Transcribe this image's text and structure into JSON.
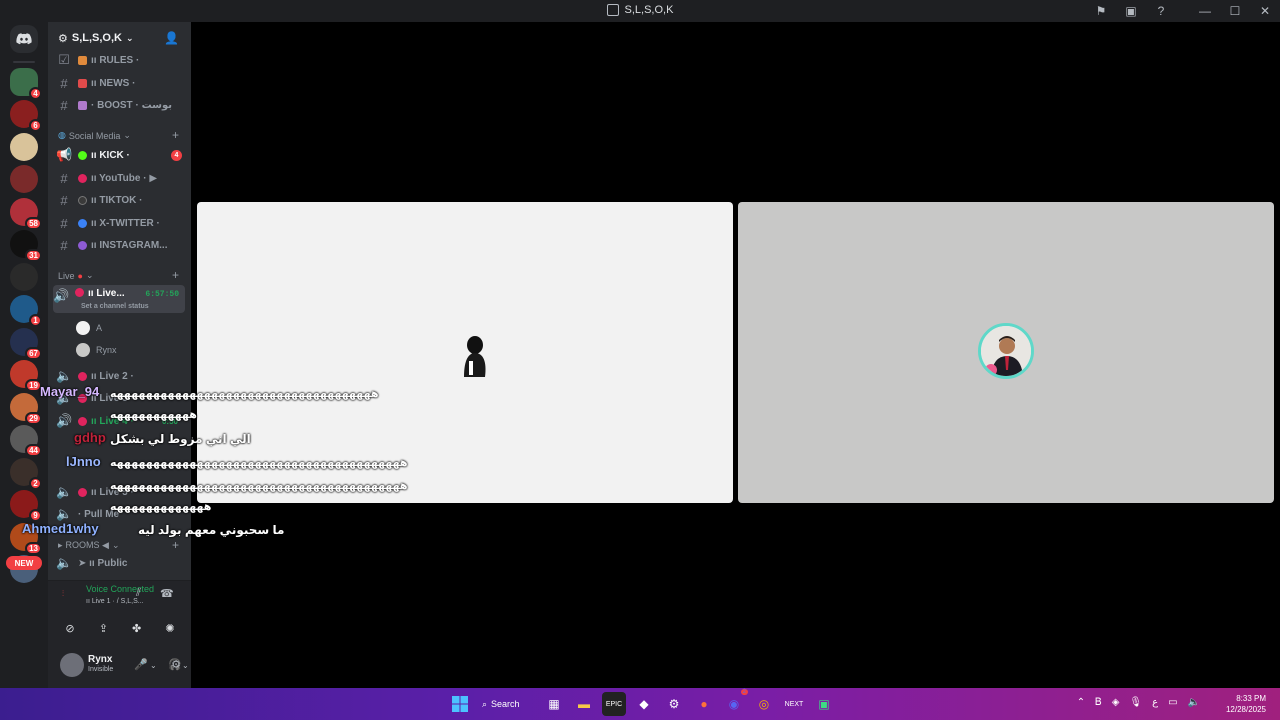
{
  "window": {
    "title": "S,L,S,O,K"
  },
  "server": {
    "name": "S,L,S,O,K"
  },
  "rail": {
    "servers": [
      {
        "badge": "4",
        "color": "#3b6e4a",
        "active": true
      },
      {
        "badge": "6",
        "color": "#8a1f1f"
      },
      {
        "badge": "",
        "color": "#d9c39a"
      },
      {
        "badge": "",
        "color": "#7a2a2a"
      },
      {
        "badge": "58",
        "color": "#b0303a"
      },
      {
        "badge": "31",
        "color": "#111111"
      },
      {
        "badge": "",
        "color": "#2a2a2a"
      },
      {
        "badge": "1",
        "color": "#1f5a8a"
      },
      {
        "badge": "67",
        "color": "#25304f"
      },
      {
        "badge": "19",
        "color": "#c0392b"
      },
      {
        "badge": "29",
        "color": "#c46a3a"
      },
      {
        "badge": "44",
        "color": "#5a5a5a"
      },
      {
        "badge": "2",
        "color": "#3a2f2a"
      },
      {
        "badge": "9",
        "color": "#8b1a1a"
      },
      {
        "badge": "13",
        "color": "#b04a1a"
      },
      {
        "badge": "",
        "color": "#4a5f7a"
      }
    ],
    "new_label": "NEW"
  },
  "channels": {
    "rules": "ıı RULES ·",
    "news": "ıı NEWS ·",
    "boost": "· BOOST · بوست",
    "cat_social": "Social Media",
    "kick": "ıı KICK ·",
    "kick_badge": "4",
    "youtube": "ıı YouTube · ▶",
    "tiktok": "ıı TIKTOK ·",
    "xtwitter": "ıı X-TWITTER ·",
    "instagram": "ıı INSTAGRAM...",
    "cat_live": "Live",
    "live1": "ıı Live...",
    "live1_timer": "6:57:50",
    "live1_status": "Set a channel status",
    "user_a": "A",
    "user_rynx": "Rynx",
    "live2": "ıı Live 2 ·",
    "live3": "ıı Live 3 ·",
    "live4": "ıı Live 4 ·",
    "live4_timer": "0:50",
    "live5": "ıı Live 5 ·",
    "pullme": "· Pull Me",
    "cat_rooms": "ROOMS ◀",
    "public": "➤ ıı Public"
  },
  "voice": {
    "status": "Voice Connected",
    "channel": "ıı Live 1 ·  / S,L,S..."
  },
  "user": {
    "name": "Rynx",
    "status": "Invisible"
  },
  "overlay": {
    "u1": "Mayar_94",
    "m1": "ههههههههههههههههههههههههههههههههههههه",
    "m1b": "هههههههههههه",
    "u2": "gdhp",
    "m2": "الي اني مزوط لي بشكل",
    "u3": "lJnno",
    "m3": "ههههههههههههههههههههههههههههههههههههههههه",
    "m3b": "ههههههههههههههههههههههههههههههههههههههههه",
    "m3c": "هههههههههههههه",
    "u4": "Ahmed1why",
    "m4": "ما سحبوني معهم بولد ليه"
  },
  "taskbar": {
    "search": "Search",
    "time": "8:33 PM",
    "date": "12/28/2025",
    "lang": "ع",
    "discord_badge": "2"
  },
  "colors": {
    "online": "#23a55a",
    "danger": "#f23f43",
    "accent": "#5865f2"
  }
}
